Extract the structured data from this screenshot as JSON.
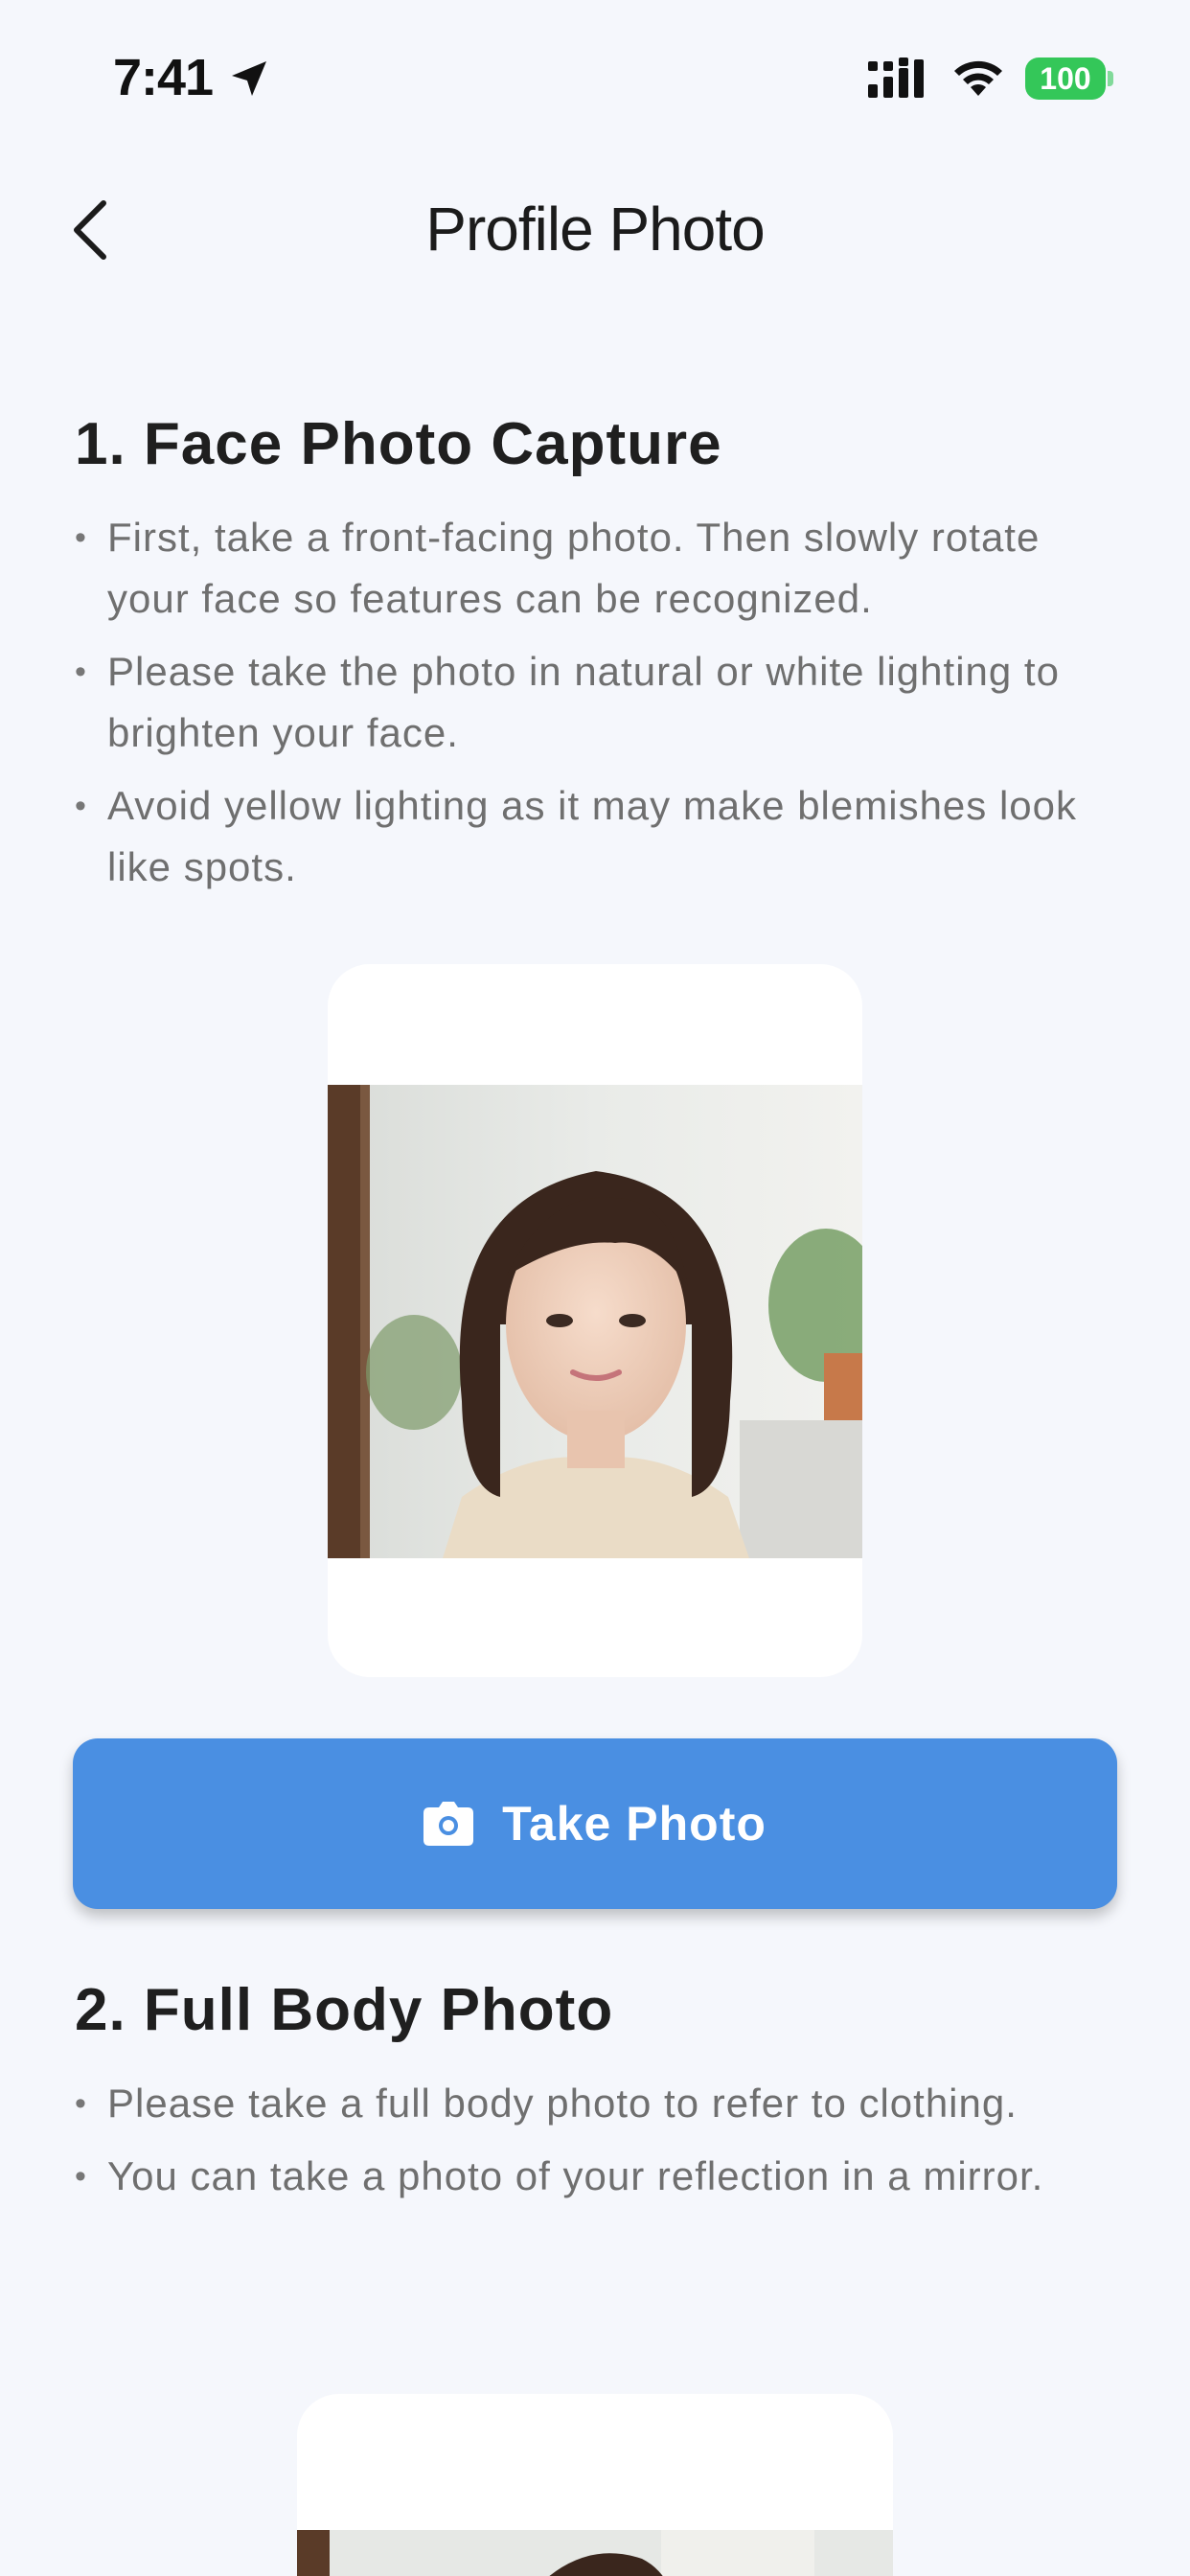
{
  "status_bar": {
    "time": "7:41",
    "battery": "100",
    "icons": [
      "location-arrow-icon",
      "cellular-signal-icon",
      "wifi-icon",
      "battery-icon"
    ]
  },
  "nav": {
    "title": "Profile Photo",
    "back_icon": "chevron-left-icon"
  },
  "section_face": {
    "title": "1. Face Photo Capture",
    "bullets": [
      "First, take a front-facing photo. Then slowly rotate your face so features can be recognized.",
      "Please take the photo in natural or white lighting to brighten your face.",
      "Avoid yellow lighting as it may make blemishes look like spots."
    ]
  },
  "take_photo_button": {
    "label": "Take Photo",
    "icon": "camera-icon"
  },
  "section_body": {
    "title": "2. Full Body Photo",
    "bullets": [
      "Please take a full body photo to refer to clothing.",
      "You can take a photo of your reflection in a mirror."
    ]
  },
  "colors": {
    "background": "#f5f7fc",
    "accent": "#4a8fe2",
    "battery": "#34c759",
    "title_text": "#1f1f1f",
    "body_text": "#6f6f6f"
  }
}
